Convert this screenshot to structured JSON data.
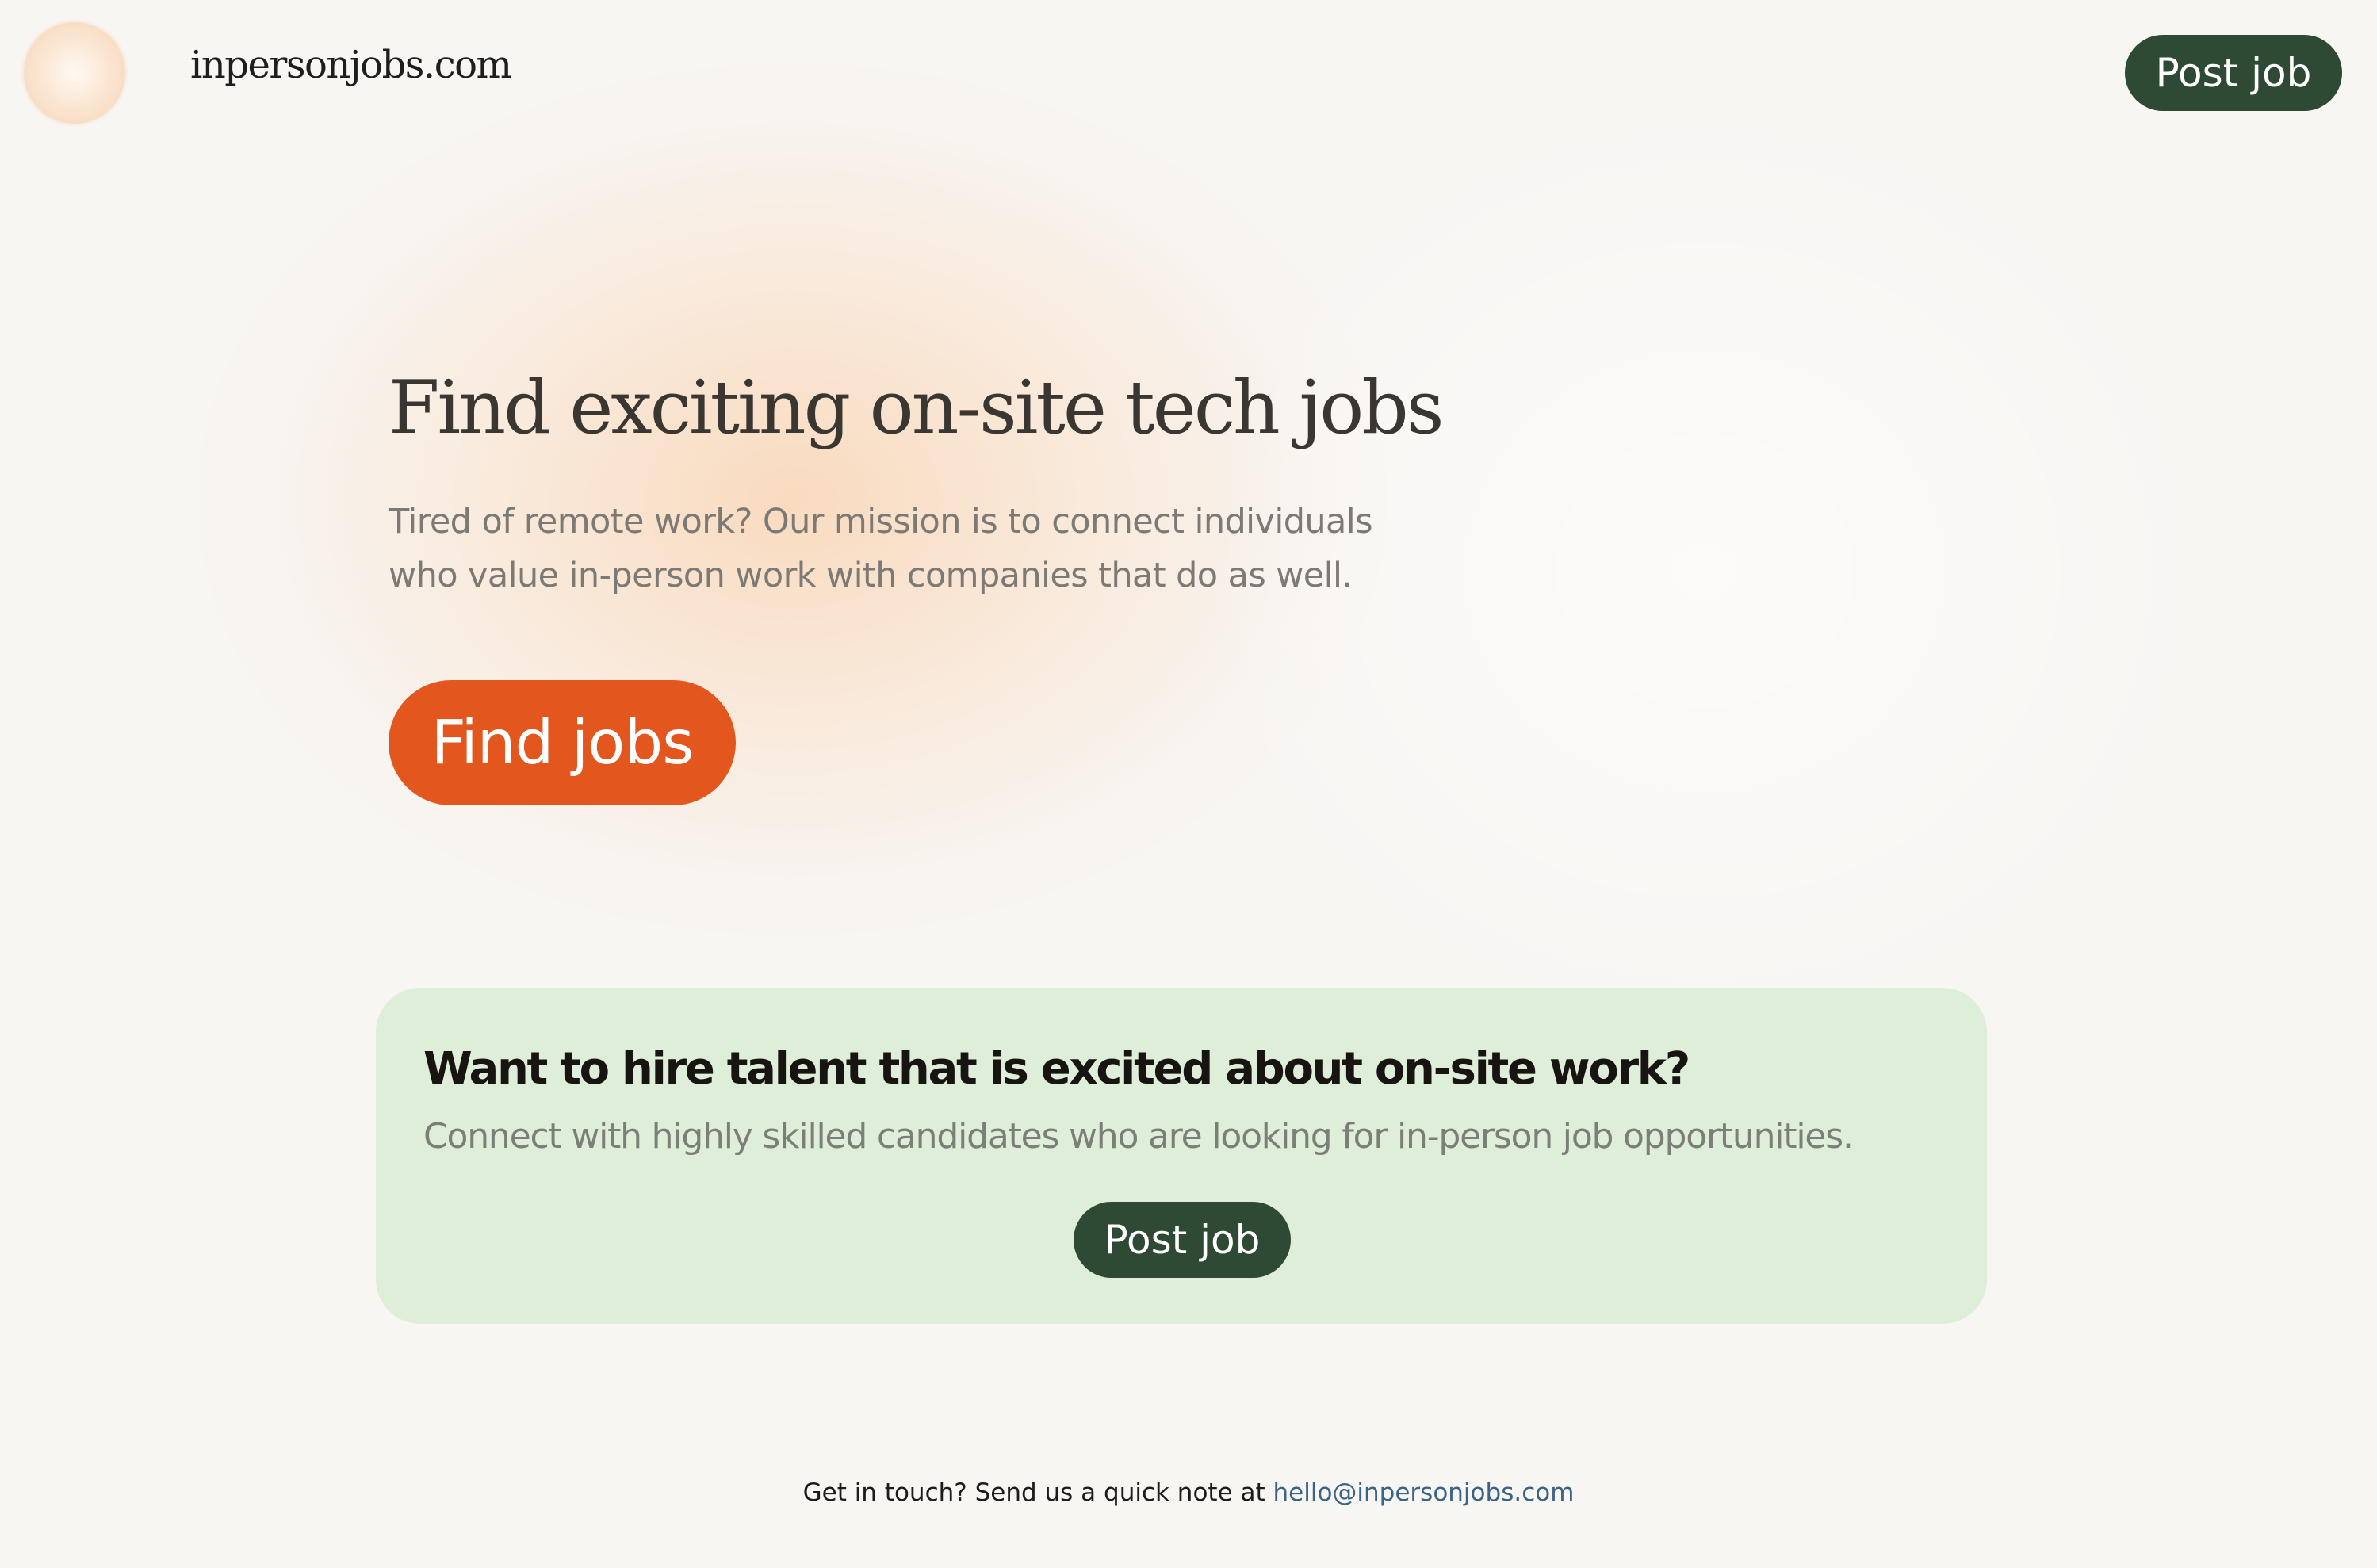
{
  "header": {
    "site_name": "inpersonjobs.com",
    "post_job_label": "Post job"
  },
  "hero": {
    "title": "Find exciting on-site tech jobs",
    "description": "Tired of remote work? Our mission is to connect individuals who value in-person work with companies that do as well.",
    "find_jobs_label": "Find jobs"
  },
  "hire_card": {
    "title": "Want to hire talent that is excited about on-site work?",
    "description": "Connect with highly skilled candidates who are looking for in-person job opportunities.",
    "post_job_label": "Post job"
  },
  "footer": {
    "text": "Get in touch? Send us a quick note at ",
    "email": "hello@inpersonjobs.com"
  },
  "colors": {
    "background": "#f8f6f3",
    "accent_orange": "#e3561d",
    "dark_green": "#2f4a34",
    "card_green": "#dfeed8",
    "link_blue": "#3b6385"
  }
}
